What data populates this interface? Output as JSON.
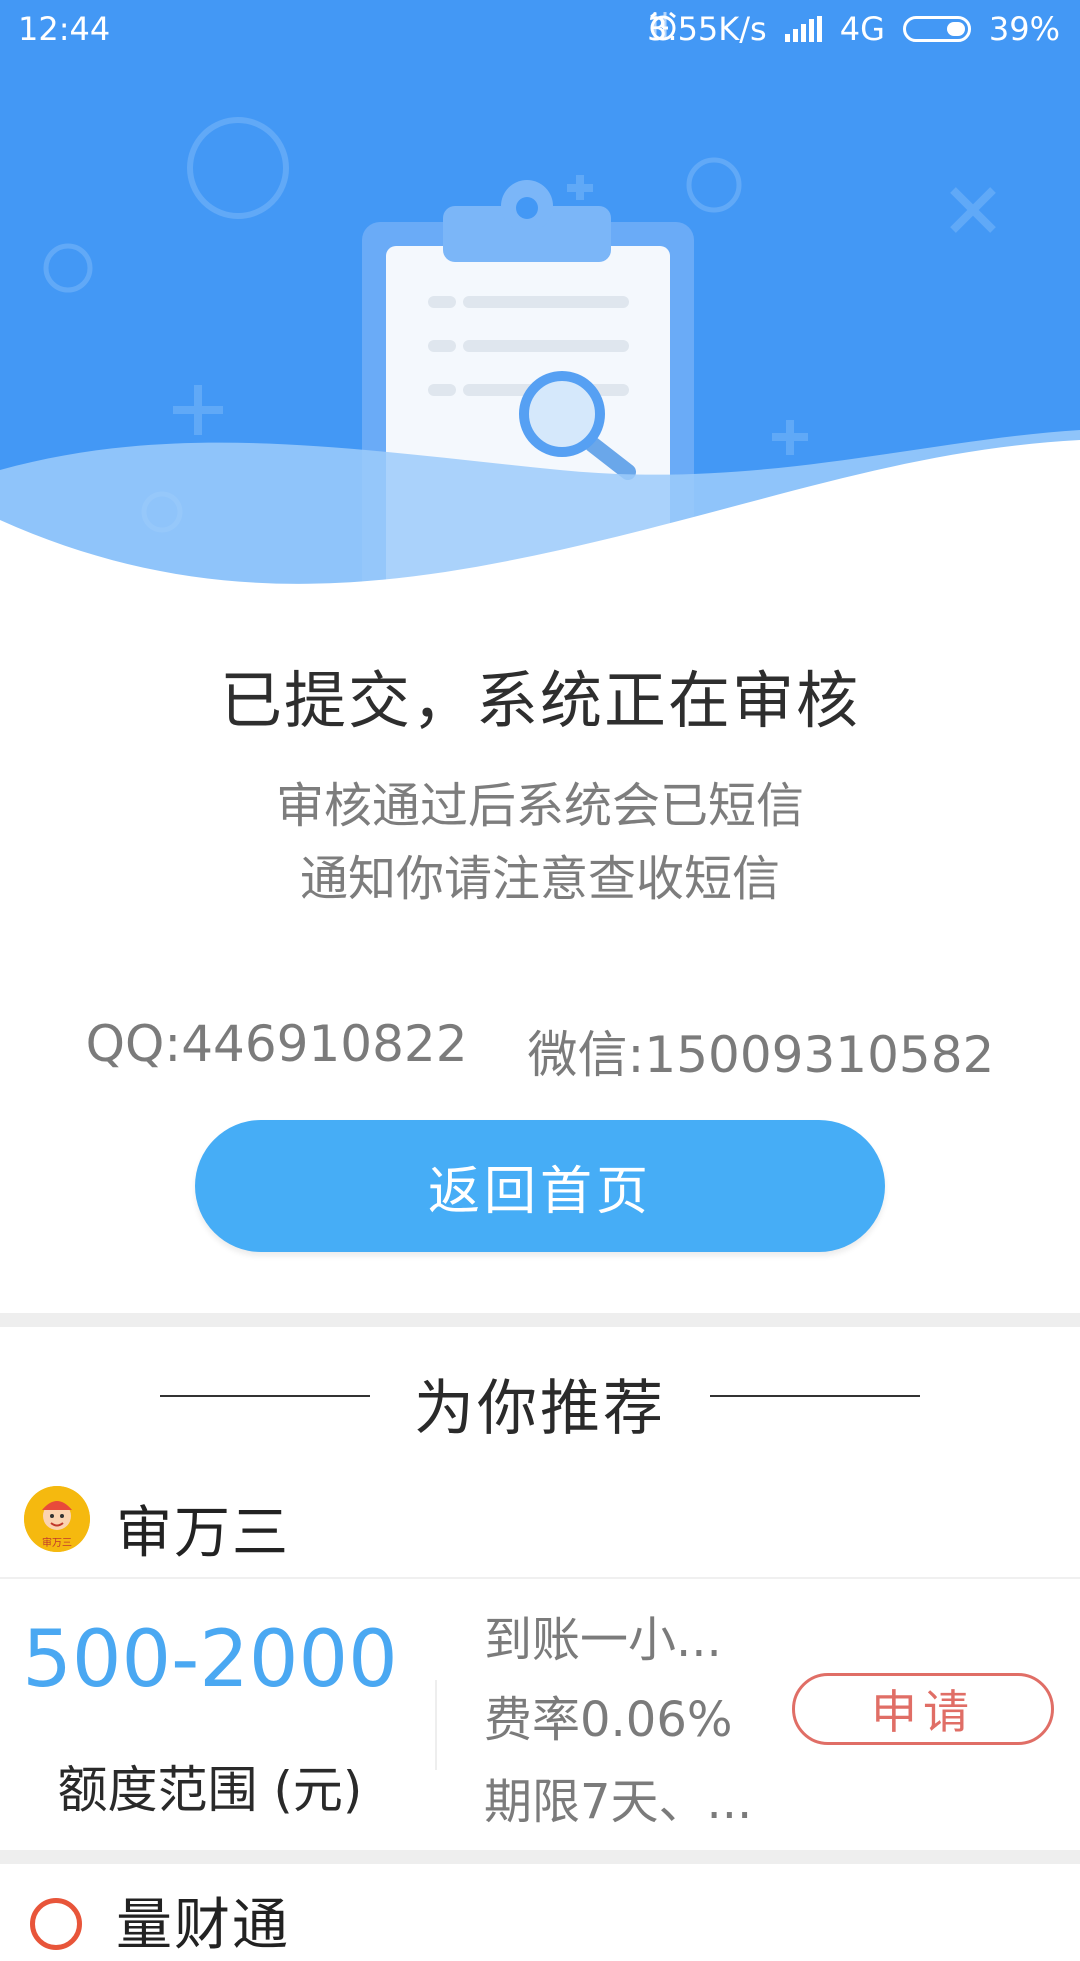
{
  "status_bar": {
    "time": "12:44",
    "net_speed": "3.55K/s",
    "network": "4G",
    "battery": "39%"
  },
  "result": {
    "title": "已提交，系统正在审核",
    "description": "审核通过后系统会已短信通知你请注意查收短信",
    "qq": "QQ:446910822",
    "wechat": "微信:15009310582",
    "home_button": "返回首页"
  },
  "recommend": {
    "heading": "为你推荐",
    "products": [
      {
        "name": "审万三",
        "logo_text": "审万三",
        "amount": "500-2000",
        "amount_label": "额度范围 (元)",
        "arrival": "到账一小...",
        "rate": "费率0.06%",
        "term": "期限7天、...",
        "apply_label": "申请"
      },
      {
        "name": "量财通"
      }
    ]
  },
  "colors": {
    "header_blue": "#4398f5",
    "button_blue": "#46adf6",
    "amount_blue": "#4aa8f2",
    "apply_red": "#e06e66"
  }
}
